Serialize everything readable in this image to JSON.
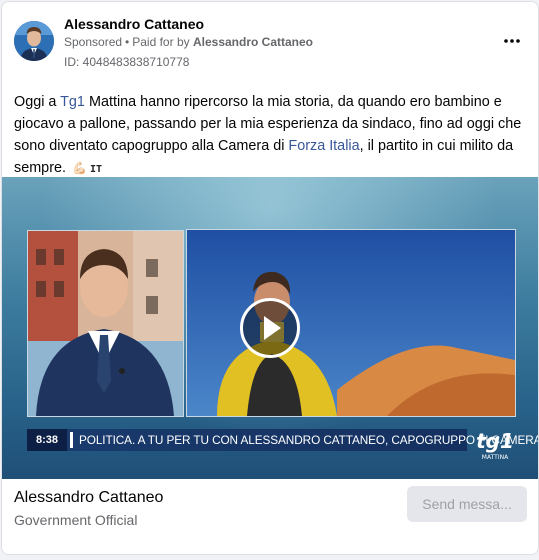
{
  "post": {
    "author_name": "Alessandro Cattaneo",
    "sponsored_label": "Sponsored",
    "paid_for_prefix": "Paid for by",
    "paid_for_name": "Alessandro Cattaneo",
    "ad_id": "ID: 4048483838710778",
    "more_icon": "more-horizontal-icon",
    "text": {
      "p1": "Oggi a ",
      "link1": "Tg1",
      "p2": " Mattina hanno ripercorso la mia storia, da quando ero bambino e giocavo a pallone, passando per la mia esperienza da sindaco, fino ad oggi che sono diventato capogruppo alla Camera di ",
      "link2": "Forza Italia",
      "p3": ", il partito in cui milito da sempre.",
      "emoji": "💪🏻",
      "flag_code": "IT"
    }
  },
  "video": {
    "play_icon": "play-icon",
    "ticker_time": "8:38",
    "ticker_text": "POLITICA. A TU PER TU CON ALESSANDRO CATTANEO, CAPOGRUPPO FI CAMERA",
    "logo_text": "tg1",
    "logo_subtext": "MATTINA"
  },
  "footer": {
    "page_name": "Alessandro Cattaneo",
    "page_category": "Government Official",
    "send_button": "Send messa..."
  },
  "colors": {
    "link": "#385898",
    "secondary_text": "#65676b",
    "button_bg": "#e4e6eb"
  }
}
